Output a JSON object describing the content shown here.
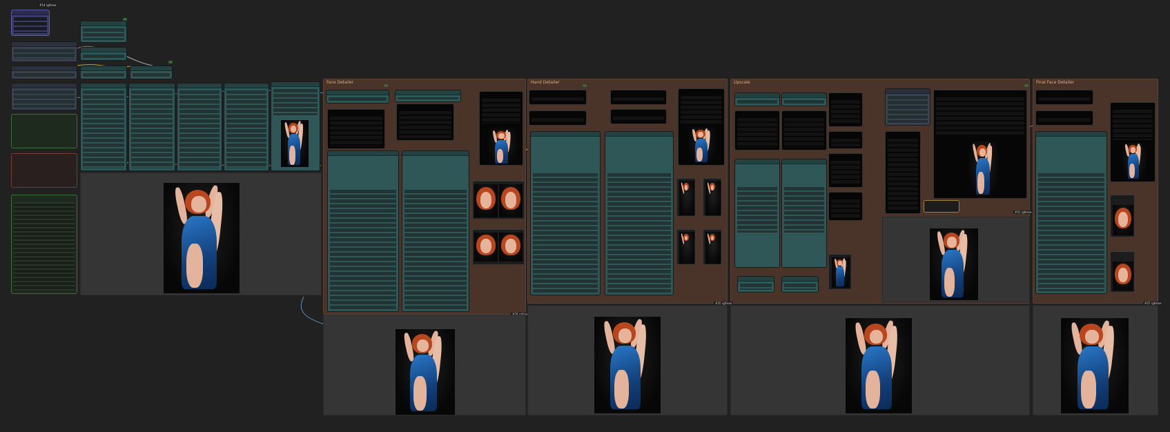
{
  "colors": {
    "canvas": "#212121",
    "node_teal": "#2f5757",
    "group_brown": "#4a3328",
    "panel": "#353535",
    "badge_green": "#3a6a3a",
    "wire_pink": "#c86c9c",
    "wire_blue": "#6aa4d8",
    "wire_yellow": "#d8c04a"
  },
  "groups": [
    {
      "title": "Face Detailer"
    },
    {
      "title": "Hand Detailer"
    },
    {
      "title": "Upscale"
    },
    {
      "title": "Final Face Detailer"
    }
  ],
  "badges": {
    "top_left": "#14 rgthree",
    "g1": "#28 rgthree",
    "g2": "#35 rgthree",
    "g3": "#41 rgthree",
    "g4": "#47 rgthree"
  },
  "icons": [
    "portrait-image-icon",
    "face-crop-icon",
    "hand-crop-icon",
    "link-wire-icon"
  ]
}
